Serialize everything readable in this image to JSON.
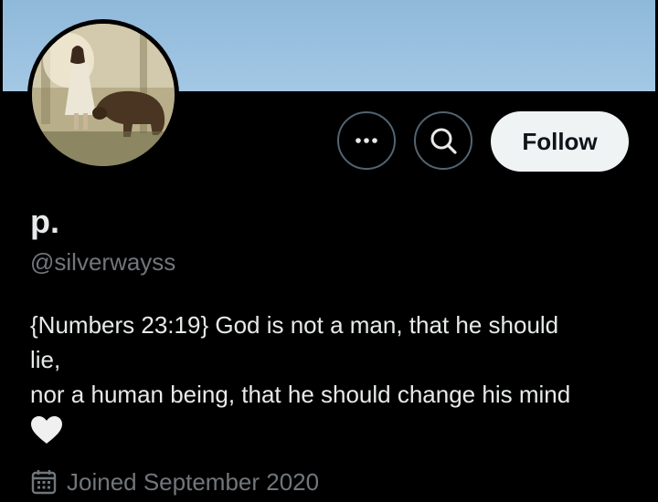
{
  "profile": {
    "display_name": "p.",
    "handle": "@silverwayss",
    "bio_lines": [
      "{Numbers 23:19} God is not a man, that he should",
      "lie,",
      "nor a human being, that he should change his mind"
    ],
    "joined": "Joined September 2020"
  },
  "actions": {
    "follow_label": "Follow"
  },
  "icons": {
    "more": "more-icon",
    "search": "search-icon",
    "heart": "white-heart-emoji",
    "calendar": "calendar-icon"
  },
  "colors": {
    "background": "#000000",
    "banner": "#a3c8e4",
    "follow_button_bg": "#eff3f4",
    "secondary_text": "#71767b",
    "primary_text": "#e7e9ea"
  }
}
